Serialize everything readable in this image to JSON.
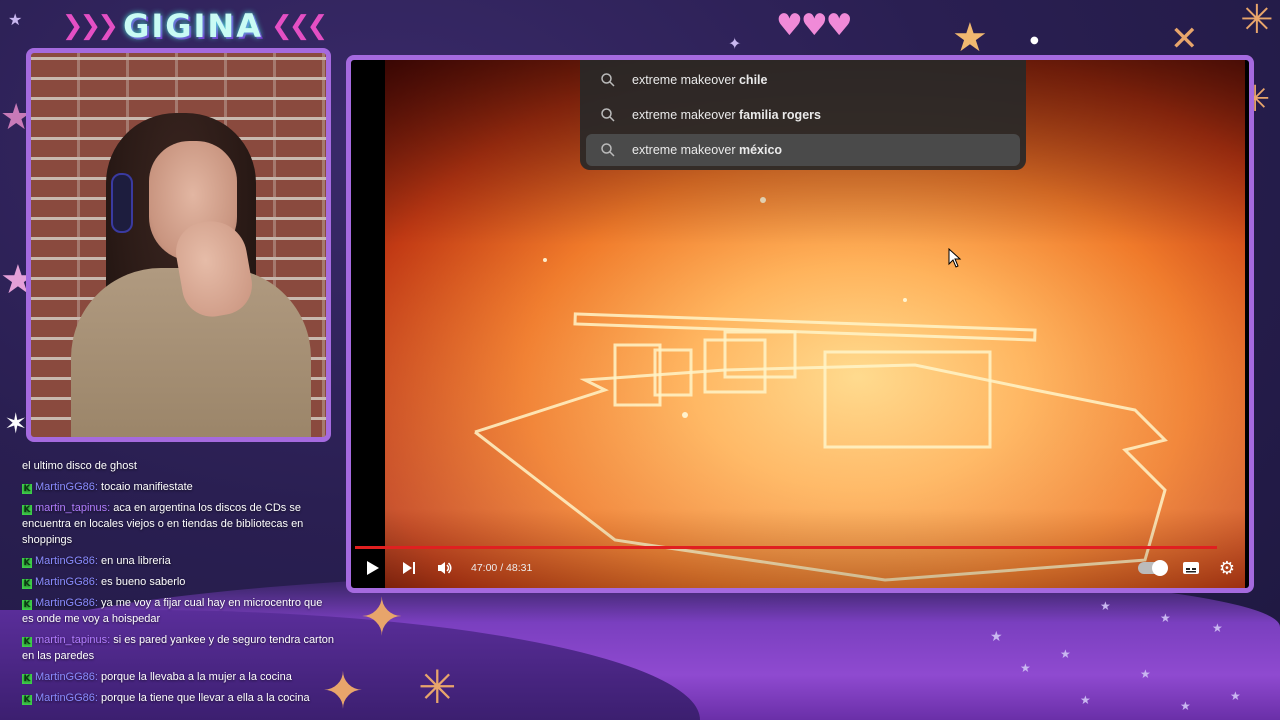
{
  "overlay": {
    "logo_text": "GIGINA",
    "logo_chevrons_left": "❯❯❯",
    "logo_chevrons_right": "❮❮❮",
    "hearts": "♥♥♥",
    "colors": {
      "frame": "#a56adf",
      "logo": "#c9fbf4",
      "progress": "#e02020"
    }
  },
  "search_suggestions": [
    {
      "prefix": "extreme makeover ",
      "bold": "chile",
      "active": false
    },
    {
      "prefix": "extreme makeover ",
      "bold": "familia rogers",
      "active": false
    },
    {
      "prefix": "extreme makeover ",
      "bold": "méxico",
      "active": true
    }
  ],
  "player": {
    "time_display": "47:00 / 48:31",
    "progress_fraction": 0.969
  },
  "chat": [
    {
      "user": "",
      "text": "el ultimo disco de ghost",
      "badge": false,
      "user_color": ""
    },
    {
      "user": "MartinGG86:",
      "text": "tocaio manifiestate",
      "badge": true,
      "user_color": "blue"
    },
    {
      "user": "martin_tapinus:",
      "text": "aca en argentina los discos de CDs se encuentra en locales viejos o en tiendas de bibliotecas en shoppings",
      "badge": true,
      "user_color": "purple"
    },
    {
      "user": "MartinGG86:",
      "text": "en una libreria",
      "badge": true,
      "user_color": "blue"
    },
    {
      "user": "MartinGG86:",
      "text": "es bueno saberlo",
      "badge": true,
      "user_color": "blue"
    },
    {
      "user": "MartinGG86:",
      "text": "ya me voy a fijar cual hay en microcentro que es onde me voy a hoispedar",
      "badge": true,
      "user_color": "blue"
    },
    {
      "user": "martin_tapinus:",
      "text": "si es pared yankee y de seguro tendra carton en las paredes",
      "badge": true,
      "user_color": "purple"
    },
    {
      "user": "MartinGG86:",
      "text": "porque la llevaba a la mujer a la cocina",
      "badge": true,
      "user_color": "blue"
    },
    {
      "user": "MartinGG86:",
      "text": "porque la tiene que llevar a ella a la cocina",
      "badge": true,
      "user_color": "blue"
    }
  ]
}
